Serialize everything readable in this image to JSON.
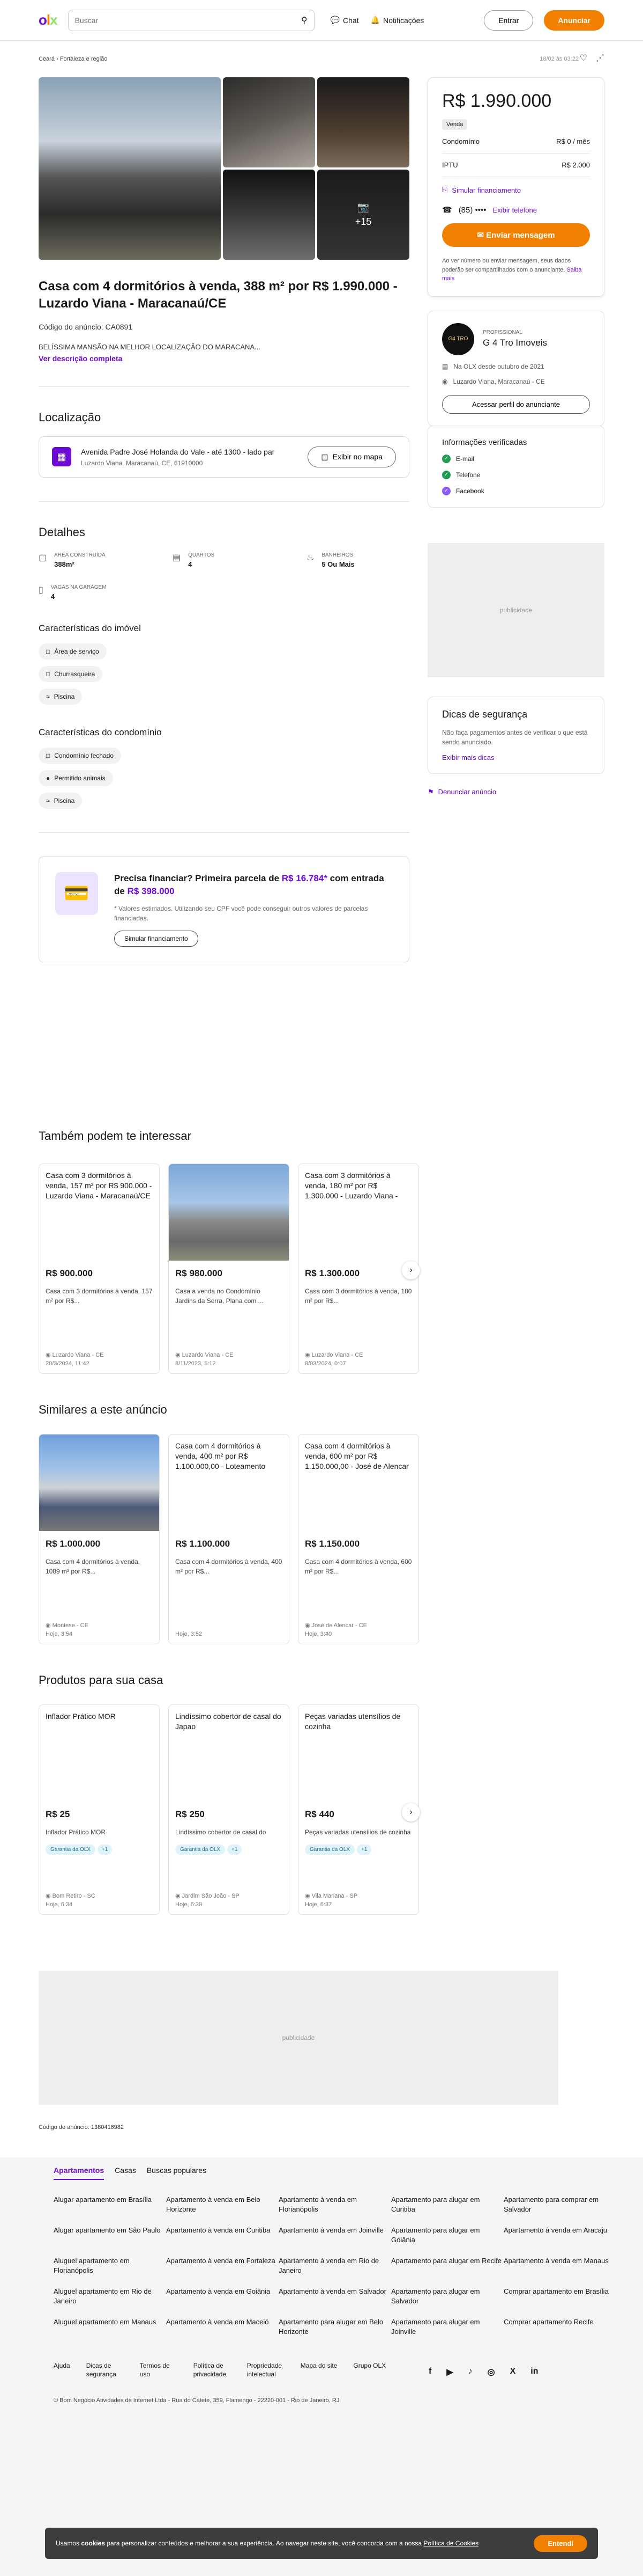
{
  "header": {
    "logo": [
      "o",
      "l",
      "x"
    ],
    "search_placeholder": "Buscar",
    "chat": "Chat",
    "notifications": "Notificações",
    "login": "Entrar",
    "announce": "Anunciar"
  },
  "breadcrumb": "Ceará  ›  Fortaleza e região",
  "meta_date": "18/02 às 03:22",
  "gallery": {
    "more_count": "+15"
  },
  "listing": {
    "title": "Casa com 4 dormitórios à venda, 388 m² por R$ 1.990.000 - Luzardo Viana - Maracanaú/CE",
    "code": "Código do anúncio: CA0891",
    "description": "BELÍSSIMA MANSÃO NA MELHOR LOCALIZAÇÃO DO MARACANA...",
    "see_more": "Ver descrição completa"
  },
  "location": {
    "title": "Localização",
    "address": "Avenida Padre José Holanda do Vale - até 1300 - lado par",
    "sub": "Luzardo Viana, Maracanaú, CE, 61910000",
    "map_button": "Exibir no mapa"
  },
  "details": {
    "title": "Detalhes",
    "items": [
      {
        "label": "ÁREA CONSTRUÍDA",
        "value": "388m²"
      },
      {
        "label": "QUARTOS",
        "value": "4"
      },
      {
        "label": "BANHEIROS",
        "value": "5 Ou Mais"
      },
      {
        "label": "VAGAS NA GARAGEM",
        "value": "4"
      }
    ]
  },
  "features": {
    "title": "Características do imóvel",
    "items": [
      "Área de serviço",
      "Churrasqueira",
      "Piscina"
    ]
  },
  "condo": {
    "title": "Características do condomínio",
    "items": [
      "Condomínio fechado",
      "Permitido animais",
      "Piscina"
    ]
  },
  "finance": {
    "title_a": "Precisa financiar? Primeira parcela de ",
    "installment": "R$ 16.784*",
    "title_b": " com entrada de ",
    "down": "R$ 398.000",
    "note": "* Valores estimados. Utilizando seu CPF você pode conseguir outros valores de parcelas financiadas.",
    "button": "Simular financiamento"
  },
  "sidebar": {
    "price": "R$ 1.990.000",
    "badge": "Venda",
    "condo_label": "Condomínio",
    "condo_value": "R$ 0 / mês",
    "iptu_label": "IPTU",
    "iptu_value": "R$ 2.000",
    "simulate": "Simular financiamento",
    "phone": "(85) ••••",
    "show_phone": "Exibir telefone",
    "message": "Enviar mensagem",
    "fine": "Ao ver número ou enviar mensagem, seus dados poderão ser compartilhados com o anunciante.",
    "fine_link": "Saiba mais",
    "seller_logo": "G4 TRO",
    "seller_type": "PROFISSIONAL",
    "seller_name": "G 4 Tro Imoveis",
    "since": "Na OLX desde outubro de 2021",
    "seller_loc": "Luzardo Viana, Maracanaú - CE",
    "profile_btn": "Acessar perfil do anunciante",
    "verified_title": "Informações verificadas",
    "verified": [
      "E-mail",
      "Telefone",
      "Facebook"
    ],
    "ad": "publicidade",
    "safety_title": "Dicas de segurança",
    "safety_text": "Não faça pagamentos antes de verificar o que está sendo anunciado.",
    "safety_link": "Exibir mais dicas",
    "report": "Denunciar anúncio"
  },
  "interest": {
    "title": "Também podem te interessar",
    "cards": [
      {
        "title": "Casa com 3 dormitórios à venda, 157 m² por R$ 900.000 - Luzardo Viana - Maracanaú/CE",
        "price": "R$ 900.000",
        "desc": "Casa com 3 dormitórios à venda, 157 m² por R$...",
        "loc": "Luzardo Viana - CE",
        "date": "20/3/2024, 11:42",
        "img": ""
      },
      {
        "title": "",
        "price": "R$ 980.000",
        "desc": "Casa a venda no Condomínio Jardins da Serra, Plana com ...",
        "loc": "Luzardo Viana - CE",
        "date": "8/11/2023, 5:12",
        "img": "photo"
      },
      {
        "title": "Casa com 3 dormitórios à venda, 180 m² por R$ 1.300.000 - Luzardo Viana - Maracanaú/CE",
        "price": "R$ 1.300.000",
        "desc": "Casa com 3 dormitórios à venda, 180 m² por R$...",
        "loc": "Luzardo Viana - CE",
        "date": "8/03/2024, 0:07",
        "img": ""
      }
    ]
  },
  "similar": {
    "title": "Similares a este anúncio",
    "cards": [
      {
        "title": "",
        "price": "R$ 1.000.000",
        "desc": "Casa com 4 dormitórios à venda, 1089 m² por R$...",
        "loc": "Montese - CE",
        "date": "Hoje, 3:54",
        "img": "photo"
      },
      {
        "title": "Casa com 4 dormitórios à venda, 400 m² por R$ 1.100.000,00 - Loteamento Novo Aquiraz - Aqu",
        "price": "R$ 1.100.000",
        "desc": "Casa com 4 dormitórios à venda, 400 m² por R$...",
        "loc": "",
        "date": "Hoje, 3:52",
        "img": ""
      },
      {
        "title": "Casa com 4 dormitórios à venda, 600 m² por R$ 1.150.000,00 - José de Alencar - Fortaleza/C",
        "price": "R$ 1.150.000",
        "desc": "Casa com 4 dormitórios à venda, 600 m² por R$...",
        "loc": "José de Alencar - CE",
        "date": "Hoje, 3:40",
        "img": ""
      }
    ]
  },
  "products": {
    "title": "Produtos para sua casa",
    "guarantee": "Garantia da OLX",
    "plus": "+1",
    "cards": [
      {
        "title": "Inflador Prático MOR",
        "price": "R$ 25",
        "desc": "Inflador Prático MOR",
        "loc": "Bom Retiro - SC",
        "date": "Hoje, 6:34"
      },
      {
        "title": "Lindíssimo cobertor de casal do Japao",
        "price": "R$ 250",
        "desc": "Lindíssimo cobertor de casal do Japao",
        "loc": "Jardim São João - SP",
        "date": "Hoje, 6:39"
      },
      {
        "title": "Peças variadas utensílios de cozinha",
        "price": "R$ 440",
        "desc": "Peças variadas utensílios de cozinha",
        "loc": "Vila Mariana - SP",
        "date": "Hoje, 6:37"
      }
    ]
  },
  "bottom_ad": "publicidade",
  "ad_code": "Código do anúncio: 1380416982",
  "footer": {
    "tabs": [
      "Apartamentos",
      "Casas",
      "Buscas populares"
    ],
    "links": [
      "Alugar apartamento em Brasília",
      "Apartamento à venda em Belo Horizonte",
      "Apartamento à venda em Florianópolis",
      "Apartamento para alugar em Curitiba",
      "Apartamento para comprar em Salvador",
      "Alugar apartamento em São Paulo",
      "Apartamento à venda em Curitiba",
      "Apartamento à venda em Joinville",
      "Apartamento para alugar em Goiânia",
      "Apartamento à venda em Aracaju",
      "Aluguel apartamento em Florianópolis",
      "Apartamento à venda em Fortaleza",
      "Apartamento à venda em Rio de Janeiro",
      "Apartamento para alugar em Recife",
      "Apartamento à venda em Manaus",
      "Aluguel apartamento em Rio de Janeiro",
      "Apartamento à venda em Goiânia",
      "Apartamento à venda em Salvador",
      "Apartamento para alugar em Salvador",
      "Comprar apartamento em Brasília",
      "Aluguel apartamento em Manaus",
      "Apartamento à venda em Maceió",
      "Apartamento para alugar em Belo Horizonte",
      "Apartamento para alugar em Joinville",
      "Comprar apartamento Recife"
    ],
    "bottom_links": [
      "Ajuda",
      "Dicas de segurança",
      "Termos de uso",
      "Política de privacidade",
      "Propriedade intelectual",
      "Mapa do site",
      "Grupo OLX"
    ],
    "social": [
      "f",
      "▶",
      "♪",
      "◎",
      "X",
      "in"
    ],
    "copyright": "© Bom Negócio Atividades de Internet Ltda - Rua do Catete, 359, Flamengo - 22220-001 - Rio de Janeiro, RJ"
  },
  "cookie": {
    "text_a": "Usamos ",
    "bold": "cookies",
    "text_b": " para personalizar conteúdos e melhorar a sua experiência. Ao navegar neste site, você concorda com a nossa ",
    "link": "Política de Cookies",
    "button": "Entendi"
  }
}
